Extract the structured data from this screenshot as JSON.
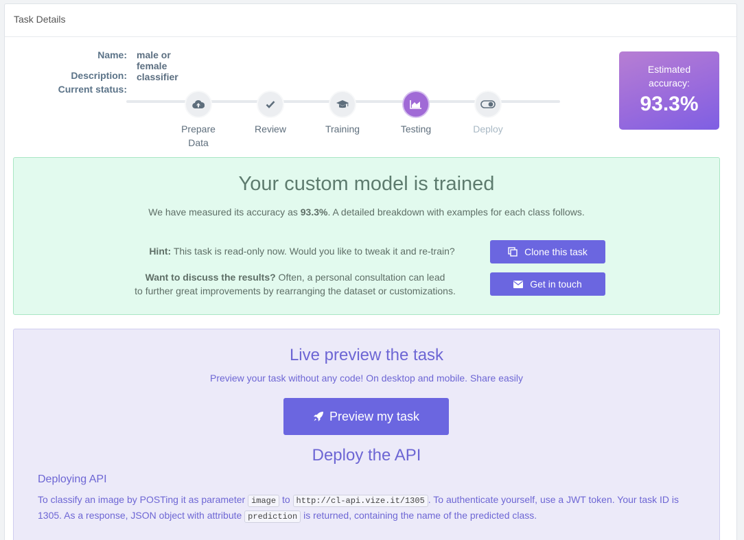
{
  "panel": {
    "title": "Task Details"
  },
  "task": {
    "name_label": "Name:",
    "name_value": "male or female classifier",
    "description_label": "Description:",
    "status_label": "Current status:"
  },
  "steps": [
    {
      "label": "Prepare Data",
      "icon": "cloud-upload-icon",
      "active": false
    },
    {
      "label": "Review",
      "icon": "check-icon",
      "active": false
    },
    {
      "label": "Training",
      "icon": "graduation-cap-icon",
      "active": false
    },
    {
      "label": "Testing",
      "icon": "area-chart-icon",
      "active": true
    },
    {
      "label": "Deploy",
      "icon": "toggle-icon",
      "active": false
    }
  ],
  "accuracy": {
    "label": "Estimated accuracy:",
    "value": "93.3%"
  },
  "success": {
    "title": "Your custom model is trained",
    "sub_before": "We have measured its accuracy as ",
    "sub_value": "93.3%",
    "sub_after": ". A detailed breakdown with examples for each class follows.",
    "hint_bold": "Hint:",
    "hint_text": " This task is read-only now. Would you like to tweak it and re-train?",
    "discuss_bold": "Want to discuss the results?",
    "discuss_text_1": " Often, a personal consultation can lead",
    "discuss_text_2": "to further great improvements by rearranging the dataset or customizations.",
    "clone_label": "Clone this task",
    "contact_label": "Get in touch"
  },
  "preview": {
    "title": "Live preview the task",
    "subtitle": "Preview your task without any code! On desktop and mobile. Share easily",
    "button_label": "Preview my task"
  },
  "deploy": {
    "title": "Deploy the API",
    "subtitle": "Deploying API",
    "text_1": "To classify an image by POSTing it as parameter ",
    "code_param": "image",
    "text_2": " to ",
    "code_url": "http://cl-api.vize.it/1305",
    "text_3": ". To authenticate yourself, use a JWT token. Your task ID is 1305. As a response, JSON object with attribute ",
    "code_attr": "prediction",
    "text_4": " is returned, containing the name of the predicted class."
  },
  "colors": {
    "accent": "#6b66e0",
    "success_bg": "#e2faee",
    "preview_bg": "#eceaf9",
    "accuracy_gradient_start": "#b77ed3",
    "accuracy_gradient_end": "#7e5fe3"
  }
}
